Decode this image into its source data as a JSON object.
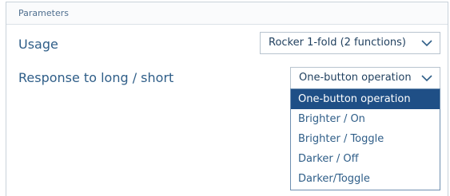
{
  "panel": {
    "title": "Parameters"
  },
  "usage": {
    "label": "Usage",
    "value": "Rocker 1-fold (2 functions)"
  },
  "response": {
    "label": "Response to long / short",
    "value": "One-button operation"
  },
  "dropdown": {
    "options": [
      {
        "label": "One-button operation",
        "selected": true
      },
      {
        "label": "Brighter / On",
        "selected": false
      },
      {
        "label": "Brighter / Toggle",
        "selected": false
      },
      {
        "label": "Darker / Off",
        "selected": false
      },
      {
        "label": "Darker/Toggle",
        "selected": false
      }
    ]
  },
  "colors": {
    "accent": "#1f4f86",
    "text": "#2f5e88",
    "border": "#b8c4cf"
  },
  "icons": {
    "select_chevron": "chevron-down-icon"
  }
}
